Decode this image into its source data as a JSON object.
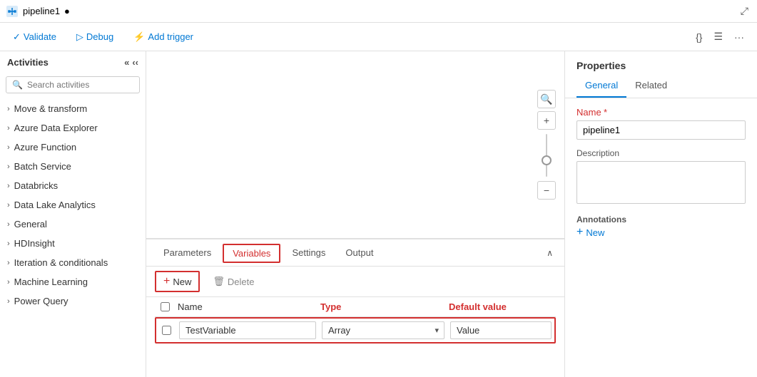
{
  "titleBar": {
    "pipelineName": "pipeline1",
    "dot": "●"
  },
  "toolbar": {
    "validateLabel": "Validate",
    "debugLabel": "Debug",
    "addTriggerLabel": "Add trigger"
  },
  "sidebar": {
    "heading": "Activities",
    "searchPlaceholder": "Search activities",
    "items": [
      {
        "label": "Move & transform"
      },
      {
        "label": "Azure Data Explorer"
      },
      {
        "label": "Azure Function"
      },
      {
        "label": "Batch Service"
      },
      {
        "label": "Databricks"
      },
      {
        "label": "Data Lake Analytics"
      },
      {
        "label": "General"
      },
      {
        "label": "HDInsight"
      },
      {
        "label": "Iteration & conditionals"
      },
      {
        "label": "Machine Learning"
      },
      {
        "label": "Power Query"
      }
    ]
  },
  "tabs": [
    {
      "label": "Parameters",
      "active": false
    },
    {
      "label": "Variables",
      "active": true
    },
    {
      "label": "Settings",
      "active": false
    },
    {
      "label": "Output",
      "active": false
    }
  ],
  "panelToolbar": {
    "newLabel": "New",
    "deleteLabel": "Delete"
  },
  "variablesTable": {
    "columns": [
      "Name",
      "Type",
      "Default value"
    ],
    "rows": [
      {
        "name": "TestVariable",
        "type": "Array",
        "defaultValue": "Value"
      }
    ]
  },
  "properties": {
    "heading": "Properties",
    "tabs": [
      "General",
      "Related"
    ],
    "activeTab": "General",
    "nameLabel": "Name",
    "nameRequired": true,
    "nameValue": "pipeline1",
    "descriptionLabel": "Description",
    "descriptionValue": "",
    "annotationsLabel": "Annotations",
    "newLabel": "New"
  }
}
